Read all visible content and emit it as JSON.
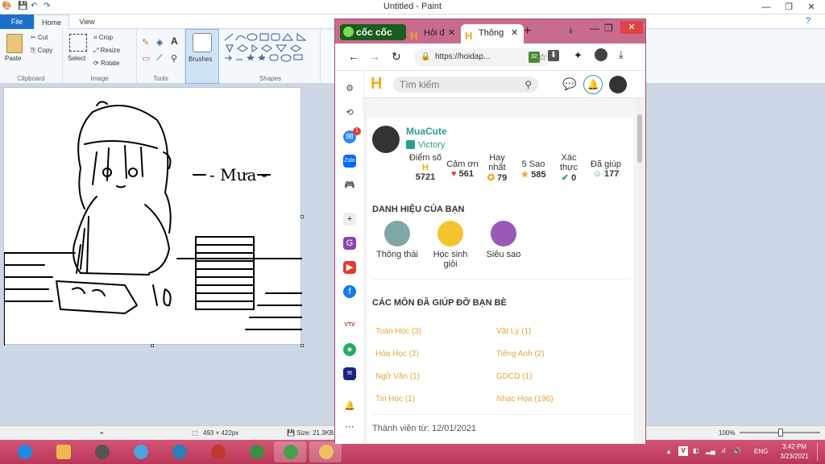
{
  "paint": {
    "title": "Untitled - Paint",
    "tabs": {
      "file": "File",
      "home": "Home",
      "view": "View"
    },
    "clipboard": {
      "paste": "Paste",
      "cut": "Cut",
      "copy": "Copy",
      "group": "Clipboard"
    },
    "image": {
      "select": "Select",
      "crop": "Crop",
      "resize": "Resize",
      "rotate": "Rotate",
      "group": "Image"
    },
    "tools": {
      "group": "Tools"
    },
    "brushes": {
      "label": "Brushes"
    },
    "shapes": {
      "group": "Shapes"
    },
    "canvas_text": "- Mưa -",
    "status": {
      "dims": "493 × 422px",
      "size": "Size: 21.3KB",
      "zoom": "100%"
    }
  },
  "browser": {
    "brand": "cốc cốc",
    "tabs": [
      {
        "label": "Hỏi đ"
      },
      {
        "label": "Thông"
      }
    ],
    "new_tab": "+",
    "url": "https://hoidap...",
    "ext_badge": "32",
    "messenger_badge": "1"
  },
  "site": {
    "search_placeholder": "Tìm kiếm",
    "user": {
      "name": "MuaCute",
      "rank": "Victory"
    },
    "stats": [
      {
        "label": "Điểm số",
        "value": "5721"
      },
      {
        "label": "Cảm ơn",
        "value": "561"
      },
      {
        "label": "Hay nhất",
        "value": "79"
      },
      {
        "label": "5 Sao",
        "value": "585"
      },
      {
        "label": "Xác thực",
        "value": "0"
      },
      {
        "label": "Đã giúp",
        "value": "177"
      }
    ],
    "badges_title": "DANH HIỆU CỦA BẠN",
    "badges": [
      {
        "label": "Thông thái",
        "color": "#7fa6a8"
      },
      {
        "label": "Học sinh giỏi",
        "color": "#f4c430"
      },
      {
        "label": "Siêu sao",
        "color": "#9b59b6"
      }
    ],
    "subjects_title": "CÁC MÔN ĐÃ GIÚP ĐỠ BẠN BÈ",
    "subjects": [
      {
        "left": "Toán Học (3)",
        "right": "Vật Lý (1)"
      },
      {
        "left": "Hóa Học (2)",
        "right": "Tiếng Anh (2)"
      },
      {
        "left": "Ngữ Văn (1)",
        "right": "GDCD (1)"
      },
      {
        "left": "Tin Học (1)",
        "right": "Nhạc Họa (196)"
      }
    ],
    "member_since": "Thành viên từ: 12/01/2021"
  },
  "taskbar": {
    "lang": "ENG",
    "time": "3:42 PM",
    "date": "3/23/2021"
  },
  "colors": {
    "accent": "#1e6fc9",
    "taskbar": "#c54262",
    "browser_frame": "#c86b8e",
    "link": "#2a9d8f",
    "subject": "#e3a53c"
  }
}
